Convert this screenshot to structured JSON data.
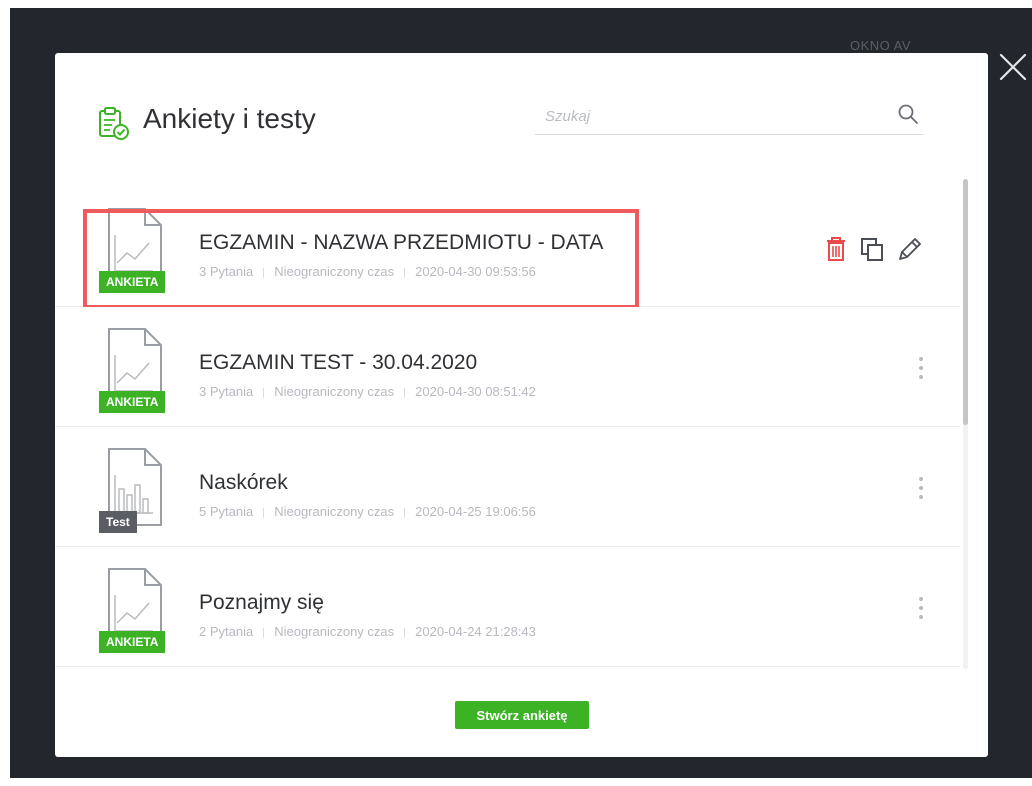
{
  "background": {
    "label": "OKNO AV"
  },
  "modal": {
    "title": "Ankiety i testy",
    "search": {
      "placeholder": "Szukaj",
      "value": ""
    },
    "create_button_label": "Stwórz ankietę"
  },
  "surveys": [
    {
      "title": "EGZAMIN - NAZWA PRZEDMIOTU - DATA",
      "badge": "ANKIETA",
      "badge_color": "#3cb324",
      "questions": "3 Pytania",
      "time": "Nieograniczony czas",
      "date": "2020-04-30 09:53:56",
      "icon": "survey-document-icon"
    },
    {
      "title": "EGZAMIN TEST - 30.04.2020",
      "badge": "ANKIETA",
      "badge_color": "#3cb324",
      "questions": "3 Pytania",
      "time": "Nieograniczony czas",
      "date": "2020-04-30 08:51:42",
      "icon": "survey-document-icon"
    },
    {
      "title": "Naskórek",
      "badge": "Test",
      "badge_color": "#5a5d63",
      "questions": "5 Pytania",
      "time": "Nieograniczony czas",
      "date": "2020-04-25 19:06:56",
      "icon": "test-document-icon"
    },
    {
      "title": "Poznajmy się",
      "badge": "ANKIETA",
      "badge_color": "#3cb324",
      "questions": "2 Pytania",
      "time": "Nieograniczony czas",
      "date": "2020-04-24 21:28:43",
      "icon": "survey-document-icon"
    }
  ],
  "colors": {
    "accent_green": "#3cb324",
    "highlight_red": "#ef5a5d",
    "delete_red": "#e84b4b"
  }
}
